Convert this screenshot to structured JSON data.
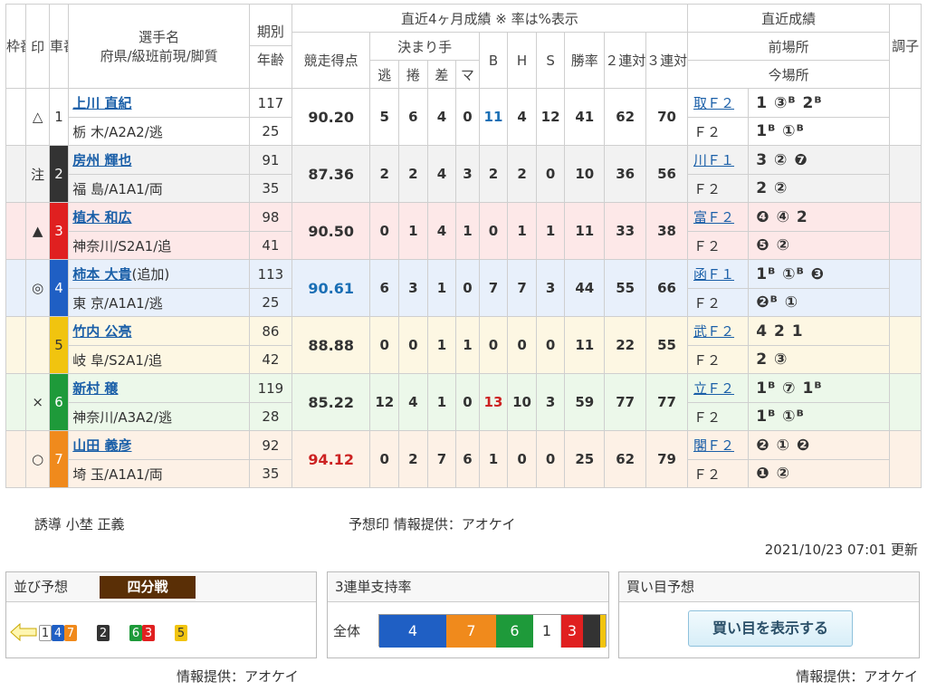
{
  "header": {
    "waku": "枠番",
    "mark": "印",
    "car": "車番",
    "name1": "選手名",
    "name2": "府県/級班前現/脚質",
    "period": "期別",
    "age": "年齢",
    "recent4": "直近4ヶ月成績 ※ 率は%表示",
    "score": "競走得点",
    "kimarite": "決まり手",
    "nige": "逃",
    "makuri": "捲",
    "sashi": "差",
    "mark_k": "マ",
    "b": "B",
    "h": "H",
    "s": "S",
    "win": "勝率",
    "ren2": "２連対率",
    "ren3": "３連対率",
    "recent": "直近成績",
    "prev": "前場所",
    "curr": "今場所",
    "cond": "調子"
  },
  "riders": [
    {
      "frame": "1",
      "frameColor": "#ffffff",
      "frameText": "#333333",
      "mark": "△",
      "car": "1",
      "name": "上川 直紀",
      "note": "",
      "pref": "栃 木/A2A2/逃",
      "period": "117",
      "age": "25",
      "score": "90.20",
      "scoreColor": "#333333",
      "nige": "5",
      "makuri": "6",
      "sashi": "4",
      "mk": "0",
      "b": "11",
      "bColor": "#1a6fb5",
      "h": "4",
      "s": "12",
      "win": "41",
      "r2": "62",
      "r3": "70",
      "prevVenue": "取Ｆ２",
      "prevRes": "1 ③ᴮ 2ᴮ",
      "currVenue": "Ｆ２",
      "currRes": "1ᴮ ①ᴮ",
      "bg": "#ffffff"
    },
    {
      "frame": "2",
      "frameColor": "#333333",
      "frameText": "#ffffff",
      "mark": "注",
      "car": "2",
      "name": "房州 輝也",
      "note": "",
      "pref": "福 島/A1A1/両",
      "period": "91",
      "age": "35",
      "score": "87.36",
      "scoreColor": "#333333",
      "nige": "2",
      "makuri": "2",
      "sashi": "4",
      "mk": "3",
      "b": "2",
      "bColor": "#333333",
      "h": "2",
      "s": "0",
      "win": "10",
      "r2": "36",
      "r3": "56",
      "prevVenue": "川Ｆ１",
      "prevRes": "3 ② ❼",
      "currVenue": "Ｆ２",
      "currRes": "2 ②",
      "bg": "#f2f2f2"
    },
    {
      "frame": "3",
      "frameColor": "#e02020",
      "frameText": "#ffffff",
      "mark": "▲",
      "car": "3",
      "name": "植木 和広",
      "note": "",
      "pref": "神奈川/S2A1/追",
      "period": "98",
      "age": "41",
      "score": "90.50",
      "scoreColor": "#333333",
      "nige": "0",
      "makuri": "1",
      "sashi": "4",
      "mk": "1",
      "b": "0",
      "bColor": "#333333",
      "h": "1",
      "s": "1",
      "win": "11",
      "r2": "33",
      "r3": "38",
      "prevVenue": "富Ｆ２",
      "prevRes": "❹ ④ 2",
      "currVenue": "Ｆ２",
      "currRes": "❺ ②",
      "bg": "#fde8e8"
    },
    {
      "frame": "4",
      "frameColor": "#1f5fc4",
      "frameText": "#ffffff",
      "mark": "◎",
      "car": "4",
      "name": "柿本 大貴",
      "note": "(追加)",
      "pref": "東 京/A1A1/逃",
      "period": "113",
      "age": "25",
      "score": "90.61",
      "scoreColor": "#1a6fb5",
      "nige": "6",
      "makuri": "3",
      "sashi": "1",
      "mk": "0",
      "b": "7",
      "bColor": "#333333",
      "h": "7",
      "s": "3",
      "win": "44",
      "r2": "55",
      "r3": "66",
      "prevVenue": "函Ｆ１",
      "prevRes": "1ᴮ ①ᴮ ❸",
      "currVenue": "Ｆ２",
      "currRes": "❷ᴮ ①",
      "bg": "#e8f0fb"
    },
    {
      "frame": "5",
      "frameColor": "#f1c40f",
      "frameText": "#333333",
      "mark": "",
      "car": "5",
      "name": "竹内 公亮",
      "note": "",
      "pref": "岐 阜/S2A1/追",
      "period": "86",
      "age": "42",
      "score": "88.88",
      "scoreColor": "#333333",
      "nige": "0",
      "makuri": "0",
      "sashi": "1",
      "mk": "1",
      "b": "0",
      "bColor": "#333333",
      "h": "0",
      "s": "0",
      "win": "11",
      "r2": "22",
      "r3": "55",
      "prevVenue": "武Ｆ２",
      "prevRes": "4 2 1",
      "currVenue": "Ｆ２",
      "currRes": "2 ③",
      "bg": "#fdf7e3"
    },
    {
      "frame": "6",
      "frameColor": "#1e9a3a",
      "frameText": "#ffffff",
      "mark": "×",
      "car": "6",
      "name": "新村 穣",
      "note": "",
      "pref": "神奈川/A3A2/逃",
      "period": "119",
      "age": "28",
      "score": "85.22",
      "scoreColor": "#333333",
      "nige": "12",
      "makuri": "4",
      "sashi": "1",
      "mk": "0",
      "b": "13",
      "bColor": "#cc2222",
      "h": "10",
      "s": "3",
      "win": "59",
      "r2": "77",
      "r3": "77",
      "prevVenue": "立Ｆ２",
      "prevRes": "1ᴮ ⑦ 1ᴮ",
      "currVenue": "Ｆ２",
      "currRes": "1ᴮ ①ᴮ",
      "bg": "#ecf8ea"
    },
    {
      "frame": "7",
      "frameColor": "#f08a1c",
      "frameText": "#ffffff",
      "mark": "○",
      "car": "7",
      "name": "山田 義彦",
      "note": "",
      "pref": "埼 玉/A1A1/両",
      "period": "92",
      "age": "35",
      "score": "94.12",
      "scoreColor": "#cc2222",
      "nige": "0",
      "makuri": "2",
      "sashi": "7",
      "mk": "6",
      "b": "1",
      "bColor": "#333333",
      "h": "0",
      "s": "0",
      "win": "25",
      "r2": "62",
      "r3": "79",
      "prevVenue": "閣Ｆ２",
      "prevRes": "❷ ① ❷",
      "currVenue": "Ｆ２",
      "currRes": "❶ ②",
      "bg": "#fdf1e6"
    }
  ],
  "footer": {
    "guide": "誘導 小埜 正義",
    "provider_mark": "予想印 情報提供：アオケイ",
    "updated": "2021/10/23 07:01 更新",
    "provider": "情報提供：アオケイ"
  },
  "line_panel": {
    "title": "並び予想",
    "badge": "四分戦",
    "groups": [
      [
        {
          "n": "1",
          "bg": "#ffffff",
          "fg": "#333333"
        },
        {
          "n": "4",
          "bg": "#1f5fc4",
          "fg": "#ffffff"
        },
        {
          "n": "7",
          "bg": "#f08a1c",
          "fg": "#ffffff"
        }
      ],
      [
        {
          "n": "2",
          "bg": "#333333",
          "fg": "#ffffff"
        }
      ],
      [
        {
          "n": "6",
          "bg": "#1e9a3a",
          "fg": "#ffffff"
        },
        {
          "n": "3",
          "bg": "#e02020",
          "fg": "#ffffff"
        }
      ],
      [
        {
          "n": "5",
          "bg": "#f1c40f",
          "fg": "#333333"
        }
      ]
    ]
  },
  "support_panel": {
    "title": "3連単支持率",
    "label": "全体",
    "segments": [
      {
        "n": "4",
        "share": 0.2963,
        "bg": "#1f5fc4",
        "fg": "#ffffff"
      },
      {
        "n": "7",
        "share": 0.2185,
        "bg": "#f08a1c",
        "fg": "#ffffff"
      },
      {
        "n": "6",
        "share": 0.163,
        "bg": "#1e9a3a",
        "fg": "#ffffff"
      },
      {
        "n": "1",
        "share": 0.1259,
        "bg": "#ffffff",
        "fg": "#333333"
      },
      {
        "n": "3",
        "share": 0.0963,
        "bg": "#e02020",
        "fg": "#ffffff"
      },
      {
        "n": "",
        "share": 0.0741,
        "bg": "#333333",
        "fg": "#ffffff"
      },
      {
        "n": "",
        "share": 0.0259,
        "bg": "#f1c40f",
        "fg": "#333333"
      }
    ]
  },
  "buy_panel": {
    "title": "買い目予想",
    "button": "買い目を表示する"
  }
}
